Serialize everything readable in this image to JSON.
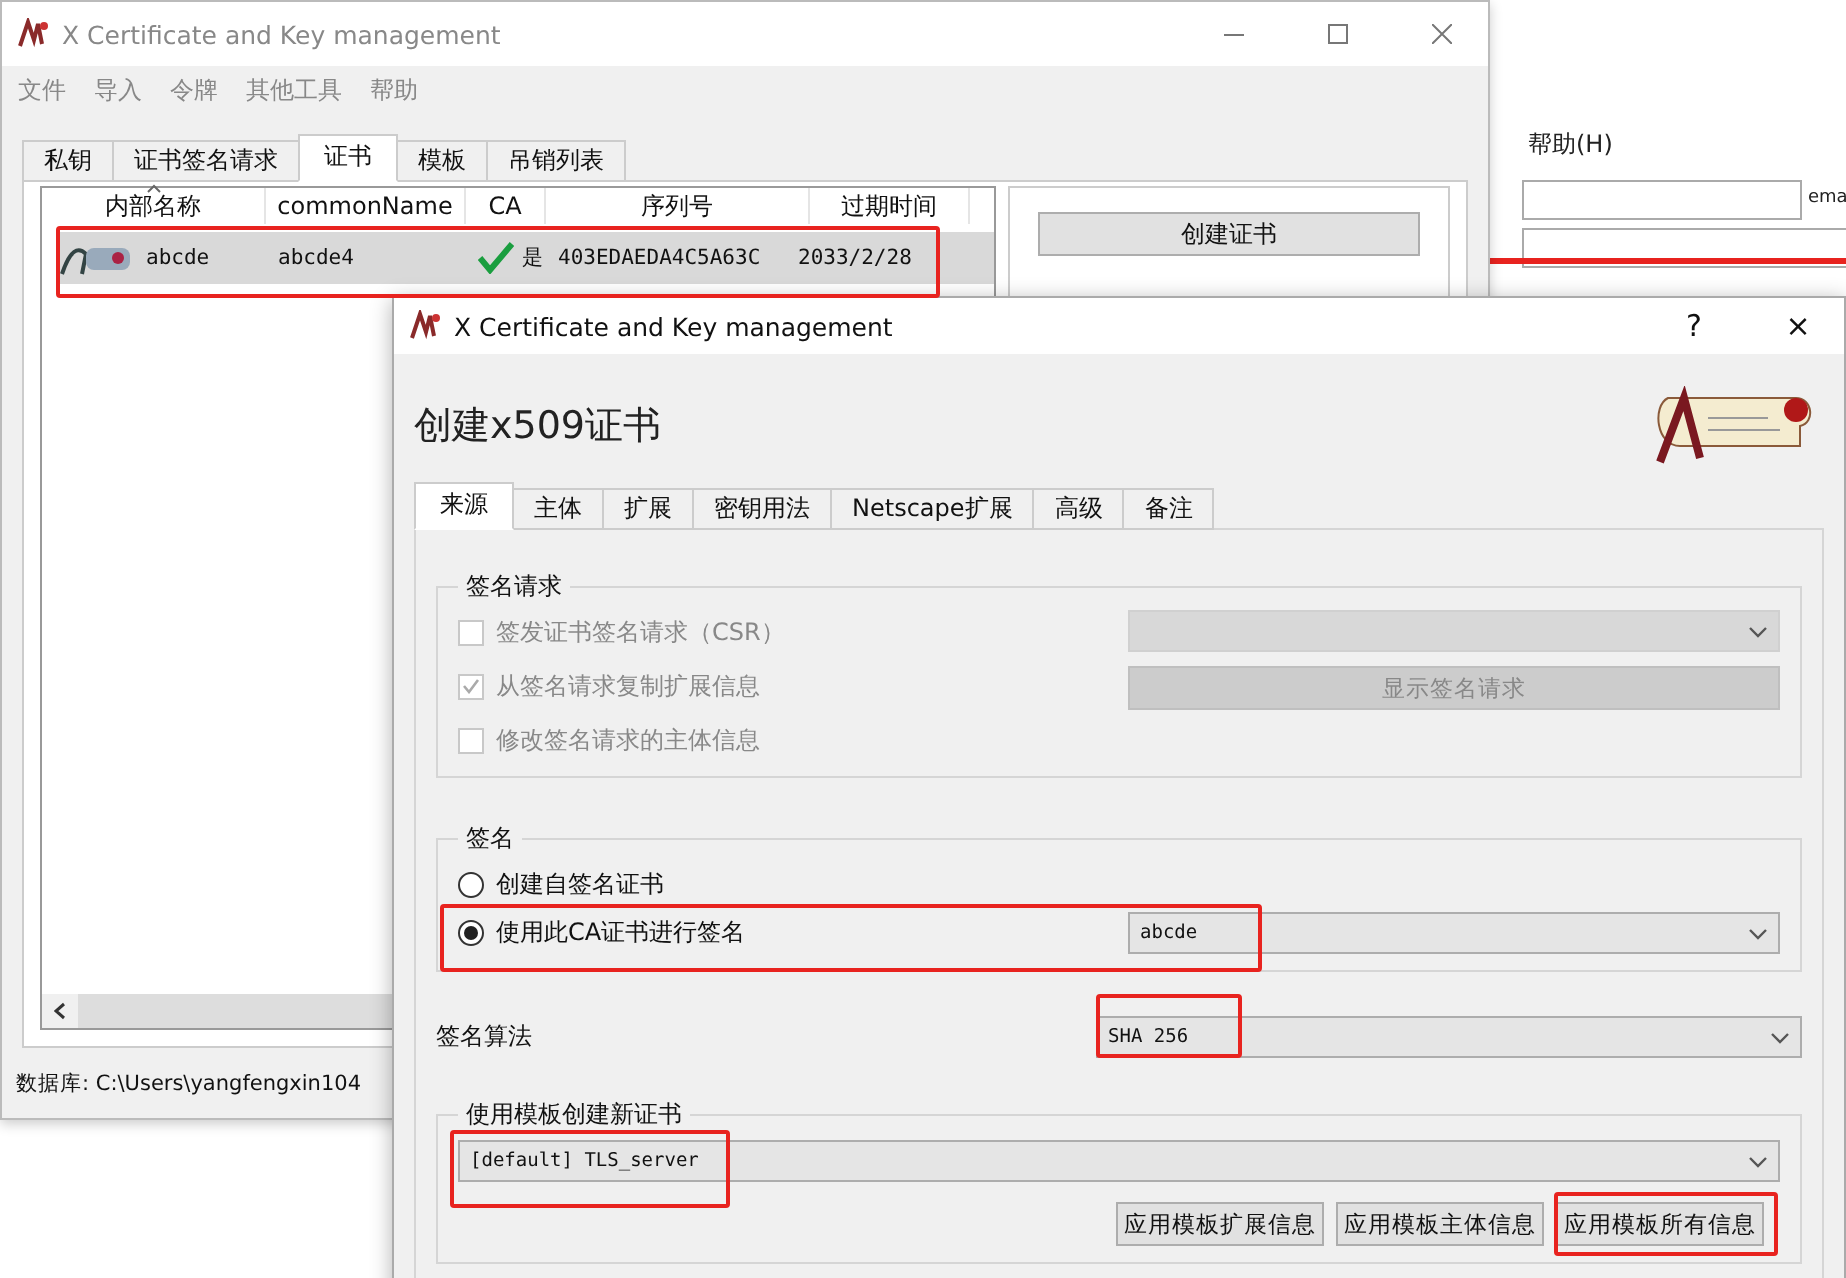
{
  "background_window": {
    "menu": [
      "帮助(H)"
    ],
    "field_label": "ema"
  },
  "main_window": {
    "title": "X Certificate and Key management",
    "active": false,
    "menu": [
      "文件",
      "导入",
      "令牌",
      "其他工具",
      "帮助"
    ],
    "tabs": [
      {
        "label": "私钥",
        "selected": false
      },
      {
        "label": "证书签名请求",
        "selected": false
      },
      {
        "label": "证书",
        "selected": true
      },
      {
        "label": "模板",
        "selected": false
      },
      {
        "label": "吊销列表",
        "selected": false
      }
    ],
    "table": {
      "columns": [
        "内部名称",
        "commonName",
        "CA",
        "序列号",
        "过期时间"
      ],
      "rows": [
        {
          "name": "abcde",
          "common_name": "abcde4",
          "ca": "是",
          "ca_valid": true,
          "serial": "403EDAEDA4C5A63C",
          "expiry": "2033/2/28",
          "selected": true
        }
      ]
    },
    "buttons": [
      "创建证书"
    ],
    "status_bar": "数据库: C:\\Users\\yangfengxin104"
  },
  "dialog": {
    "title": "X Certificate and Key management",
    "help": "?",
    "close": "×",
    "heading": "创建x509证书",
    "tabs": [
      {
        "label": "来源",
        "selected": true
      },
      {
        "label": "主体",
        "selected": false
      },
      {
        "label": "扩展",
        "selected": false
      },
      {
        "label": "密钥用法",
        "selected": false
      },
      {
        "label": "Netscape扩展",
        "selected": false
      },
      {
        "label": "高级",
        "selected": false
      },
      {
        "label": "备注",
        "selected": false
      }
    ],
    "signing_request": {
      "title": "签名请求",
      "checkboxes": [
        {
          "label": "签发证书签名请求（CSR）",
          "checked": false,
          "disabled": true
        },
        {
          "label": "从签名请求复制扩展信息",
          "checked": true,
          "disabled": true
        },
        {
          "label": "修改签名请求的主体信息",
          "checked": false,
          "disabled": true
        }
      ],
      "select_disabled": true,
      "button": {
        "label": "显示签名请求",
        "disabled": true
      }
    },
    "signing": {
      "title": "签名",
      "options": [
        {
          "label": "创建自签名证书",
          "selected": false
        },
        {
          "label": "使用此CA证书进行签名",
          "selected": true
        }
      ],
      "ca_select": "abcde"
    },
    "algorithm": {
      "label": "签名算法",
      "value": "SHA 256"
    },
    "template": {
      "title": "使用模板创建新证书",
      "value": "[default] TLS_server",
      "buttons": [
        "应用模板扩展信息",
        "应用模板主体信息",
        "应用模板所有信息"
      ]
    }
  }
}
